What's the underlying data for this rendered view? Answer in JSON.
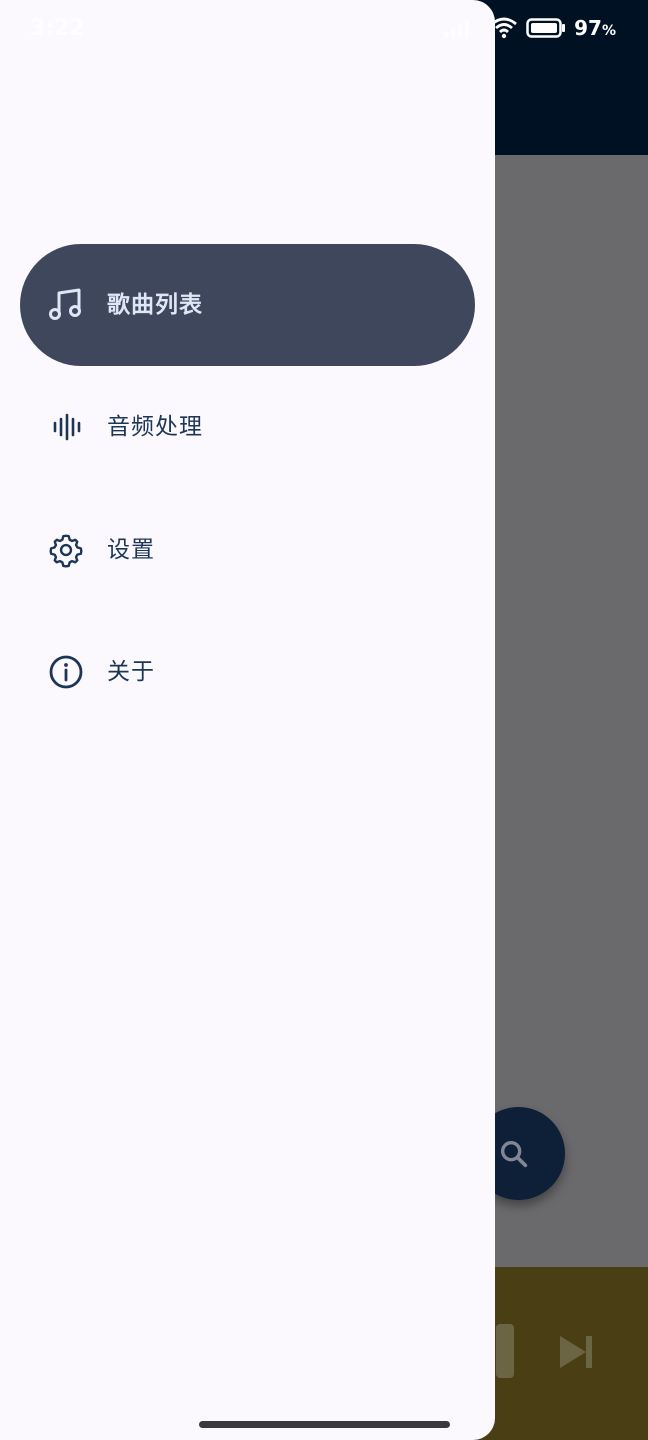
{
  "status_bar": {
    "time": "3:22",
    "battery_value": "97",
    "battery_unit": "%"
  },
  "drawer": {
    "items": [
      {
        "label": "歌曲列表",
        "icon": "music-note-icon",
        "active": true
      },
      {
        "label": "音频处理",
        "icon": "audio-waveform-icon",
        "active": false
      },
      {
        "label": "设置",
        "icon": "gear-icon",
        "active": false
      },
      {
        "label": "关于",
        "icon": "info-icon",
        "active": false
      }
    ]
  },
  "colors": {
    "drawer_bg": "#fbf8fe",
    "active_item_bg": "#3e475b",
    "active_item_text": "#dfe6f6",
    "item_text": "#1e3656",
    "app_bar": "#001124",
    "fab": "#0e1f38",
    "player_bar": "#4a3e15"
  }
}
